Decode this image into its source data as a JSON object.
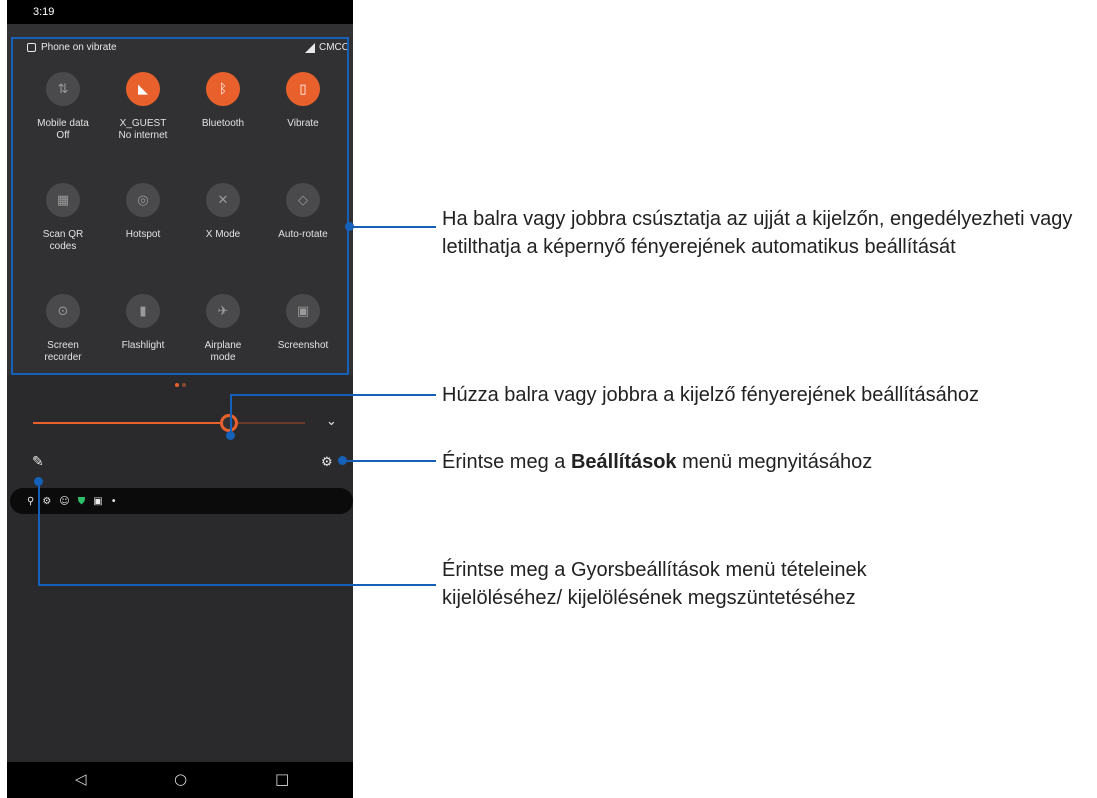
{
  "status_bar": {
    "time": "3:19"
  },
  "quick_settings": {
    "header_status": "Phone on vibrate",
    "carrier": "CMCC",
    "tiles": [
      {
        "label": "Mobile data\nOff",
        "icon": "mobile-data-icon",
        "state": "off"
      },
      {
        "label": "X_GUEST\nNo internet",
        "icon": "wifi-icon",
        "state": "on"
      },
      {
        "label": "Bluetooth",
        "icon": "bluetooth-icon",
        "state": "on"
      },
      {
        "label": "Vibrate",
        "icon": "vibrate-icon",
        "state": "on"
      },
      {
        "label": "Scan QR\ncodes",
        "icon": "qr-code-icon",
        "state": "off"
      },
      {
        "label": "Hotspot",
        "icon": "hotspot-icon",
        "state": "off"
      },
      {
        "label": "X Mode",
        "icon": "x-mode-icon",
        "state": "off"
      },
      {
        "label": "Auto-rotate",
        "icon": "auto-rotate-icon",
        "state": "off"
      },
      {
        "label": "Screen\nrecorder",
        "icon": "screen-recorder-icon",
        "state": "off"
      },
      {
        "label": "Flashlight",
        "icon": "flashlight-icon",
        "state": "off"
      },
      {
        "label": "Airplane\nmode",
        "icon": "airplane-icon",
        "state": "off"
      },
      {
        "label": "Screenshot",
        "icon": "screenshot-icon",
        "state": "off"
      }
    ],
    "brightness_level": 0.74
  },
  "annotations": {
    "tiles_swipe": "Ha balra vagy jobbra csúsztatja az ujját a kijelzőn, engedélyezheti vagy letilthatja a képernyő fényerejének automatikus beállítását",
    "brightness": "Húzza balra vagy jobbra a kijelző fényerejének beállításához",
    "settings_before": "Érintse meg a ",
    "settings_bold": "Beállítások",
    "settings_after": " menü megnyitásához",
    "edit": "Érintse meg a Gyorsbeállítások menü tételeinek kijelöléséhez/ kijelölésének megszüntetéséhez"
  },
  "colors": {
    "accent": "#e8612c",
    "callout": "#1560b8",
    "panel": "#313133"
  }
}
